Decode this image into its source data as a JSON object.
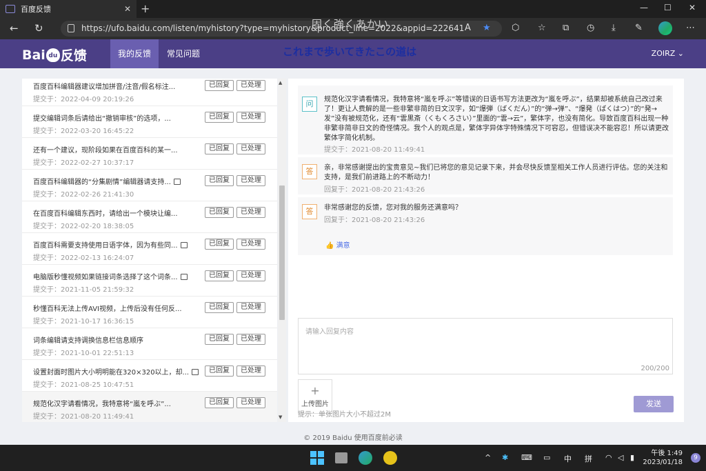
{
  "browser": {
    "tab_title": "百度反馈",
    "url": "https://ufo.baidu.com/listen/myhistory?type=myhistory&product_line=2022&appid=222641",
    "overlay_jp_top": "固く強くあかい",
    "overlay_jp_mid": "これまで歩いてきたこの道は"
  },
  "header": {
    "logo_left": "Bai",
    "logo_paw": "du",
    "logo_right": "反馈",
    "nav": [
      "我的反馈",
      "常见问题"
    ],
    "user": "ZOIRZ ⌄"
  },
  "list": {
    "replied": "已回复",
    "processed": "已处理",
    "items": [
      {
        "title": "百度百科编辑器建议增加拼音/注音/假名标注...",
        "time": "提交于：2022-04-09 20:19:26",
        "img": false
      },
      {
        "title": "提交编辑词条后请给出“撤销审核”的选项，...",
        "time": "提交于：2022-03-20 16:45:22",
        "img": false
      },
      {
        "title": "还有一个建议，现阶段如果在百度百科的某一...",
        "time": "提交于：2022-02-27 10:37:17",
        "img": false
      },
      {
        "title": "百度百科编辑器的“分集剧情”编辑器请支持...",
        "time": "提交于：2022-02-26 21:41:30",
        "img": true
      },
      {
        "title": "在百度百科编辑东西时，请给出一个模块让编...",
        "time": "提交于：2022-02-20 18:38:05",
        "img": false
      },
      {
        "title": "百度百科需要支持使用日语字体，因为有些同...",
        "time": "提交于：2022-02-13 16:24:07",
        "img": true
      },
      {
        "title": "电脑版秒懂视频如果链接词条选择了这个词条...",
        "time": "提交于：2021-11-05 21:59:32",
        "img": true
      },
      {
        "title": "秒懂百科无法上传AVI视频，上传后没有任何反...",
        "time": "提交于：2021-10-17 16:36:15",
        "img": false
      },
      {
        "title": "词条编辑请支持调换信息栏信息顺序",
        "time": "提交于：2021-10-01 22:51:13",
        "img": false
      },
      {
        "title": "设置封面时图片大小明明能在320×320以上，却...",
        "time": "提交于：2021-08-25 10:47:51",
        "img": true
      },
      {
        "title": "规范化汉字请看情况，我特意将“嵐を呼ぶ”...",
        "time": "提交于：2021-08-20 11:49:41",
        "img": false
      }
    ]
  },
  "conversation": {
    "q_badge": "问",
    "a_badge": "答",
    "question": "规范化汉字请看情况，我特意将“嵐を呼ぶ”等错误的日语书写方法更改为“嵐を呼ぶ”，结果却被系统自己改过来了！更让人费解的是一些非繁非简的日文汉字，如“爆弾（ばくだん）”的“弹→弹”、“爆発（ばくはつ）”的“発→发”没有被规范化，还有“雲黒斎（くもくろさい）”里面的“雲→云”，繁体字，也没有简化。导致百度百科出现一种非繁非简非日文的奇怪情况。我个人的观点是，繁体字异体字特殊情况下可容忍，但错误决不能容忍！所以请更改繁体字简化机制。",
    "question_time": "提交于：2021-08-20 11:49:41",
    "answer1": "亲，非常感谢提出的宝贵意见~我们已将您的意见记录下来，并会尽快反馈至相关工作人员进行评估。您的关注和支持，是我们前进路上的不断动力！",
    "answer1_time": "回复于：2021-08-20 21:43:26",
    "answer2": "非常感谢您的反馈，您对我的服务还满意吗？",
    "answer2_time": "回复于：2021-08-20 21:43:26",
    "satisfied": "满意",
    "reply_placeholder": "请输入回复内容",
    "counter": "200/200",
    "upload_label": "上传图片",
    "hint": "提示：单张图片大小不超过2M",
    "send": "发送"
  },
  "footer": "© 2019 Baidu 使用百度前必读",
  "taskbar": {
    "time": "午後 1:49",
    "date": "2023/01/18",
    "ime1": "中",
    "ime2": "拼",
    "notifications": "9"
  }
}
